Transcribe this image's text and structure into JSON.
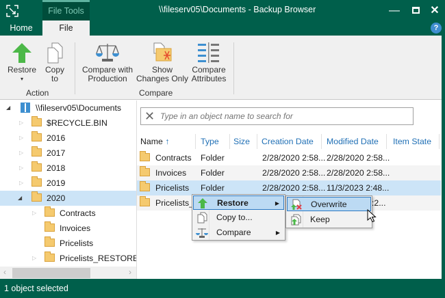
{
  "window": {
    "title": "\\\\fileserv05\\Documents - Backup Browser",
    "context_tab": "File Tools",
    "minimize_icon": "minimize-icon",
    "maximize_icon": "maximize-icon",
    "close_icon": "close-icon",
    "help_label": "?"
  },
  "tabs": [
    {
      "label": "Home"
    },
    {
      "label": "File",
      "active": true
    }
  ],
  "ribbon": {
    "groups": [
      {
        "label": "Action",
        "buttons": [
          {
            "label1": "Restore",
            "label2": "▾",
            "icon": "restore-arrow-icon"
          },
          {
            "label1": "Copy",
            "label2": "to",
            "icon": "copy-icon"
          }
        ]
      },
      {
        "label": "Compare",
        "buttons": [
          {
            "label1": "Compare with",
            "label2": "Production",
            "icon": "scales-icon"
          },
          {
            "label1": "Show",
            "label2": "Changes Only",
            "icon": "changes-icon"
          },
          {
            "label1": "Compare",
            "label2": "Attributes",
            "icon": "attributes-icon"
          }
        ]
      }
    ]
  },
  "tree": {
    "root": "\\\\fileserv05\\Documents",
    "items": [
      {
        "label": "$RECYCLE.BIN"
      },
      {
        "label": "2016"
      },
      {
        "label": "2017"
      },
      {
        "label": "2018"
      },
      {
        "label": "2019"
      },
      {
        "label": "2020",
        "selected": true
      }
    ],
    "children": [
      {
        "label": "Contracts"
      },
      {
        "label": "Invoices"
      },
      {
        "label": "Pricelists"
      },
      {
        "label": "Pricelists_RESTORED_"
      }
    ]
  },
  "search": {
    "placeholder": "Type in an object name to search for"
  },
  "table": {
    "columns": [
      "Name",
      "Type",
      "Size",
      "Creation Date",
      "Modified Date",
      "Item State"
    ],
    "sort_icon": "↑",
    "rows": [
      {
        "name": "Contracts",
        "type": "Folder",
        "size": "",
        "created": "2/28/2020 2:58...",
        "modified": "2/28/2020 2:58...",
        "state": ""
      },
      {
        "name": "Invoices",
        "type": "Folder",
        "size": "",
        "created": "2/28/2020 2:58...",
        "modified": "2/28/2020 2:58...",
        "state": ""
      },
      {
        "name": "Pricelists",
        "type": "Folder",
        "size": "",
        "created": "2/28/2020 2:58...",
        "modified": "11/3/2023 2:48...",
        "state": "",
        "selected": true
      },
      {
        "name": "Pricelists_...",
        "type": "",
        "size": "",
        "created": "",
        "modified": ":2...",
        "state": ""
      }
    ]
  },
  "context_menu": {
    "items": [
      {
        "label": "Restore",
        "submenu": true
      },
      {
        "label": "Copy to..."
      },
      {
        "label": "Compare",
        "submenu": true
      }
    ],
    "submenu": [
      {
        "label": "Overwrite"
      },
      {
        "label": "Keep"
      }
    ]
  },
  "status": {
    "text": "1 object selected"
  },
  "colors": {
    "brand": "#005f4b",
    "selection": "#cce4f7",
    "header_text": "#1f6fb5"
  }
}
